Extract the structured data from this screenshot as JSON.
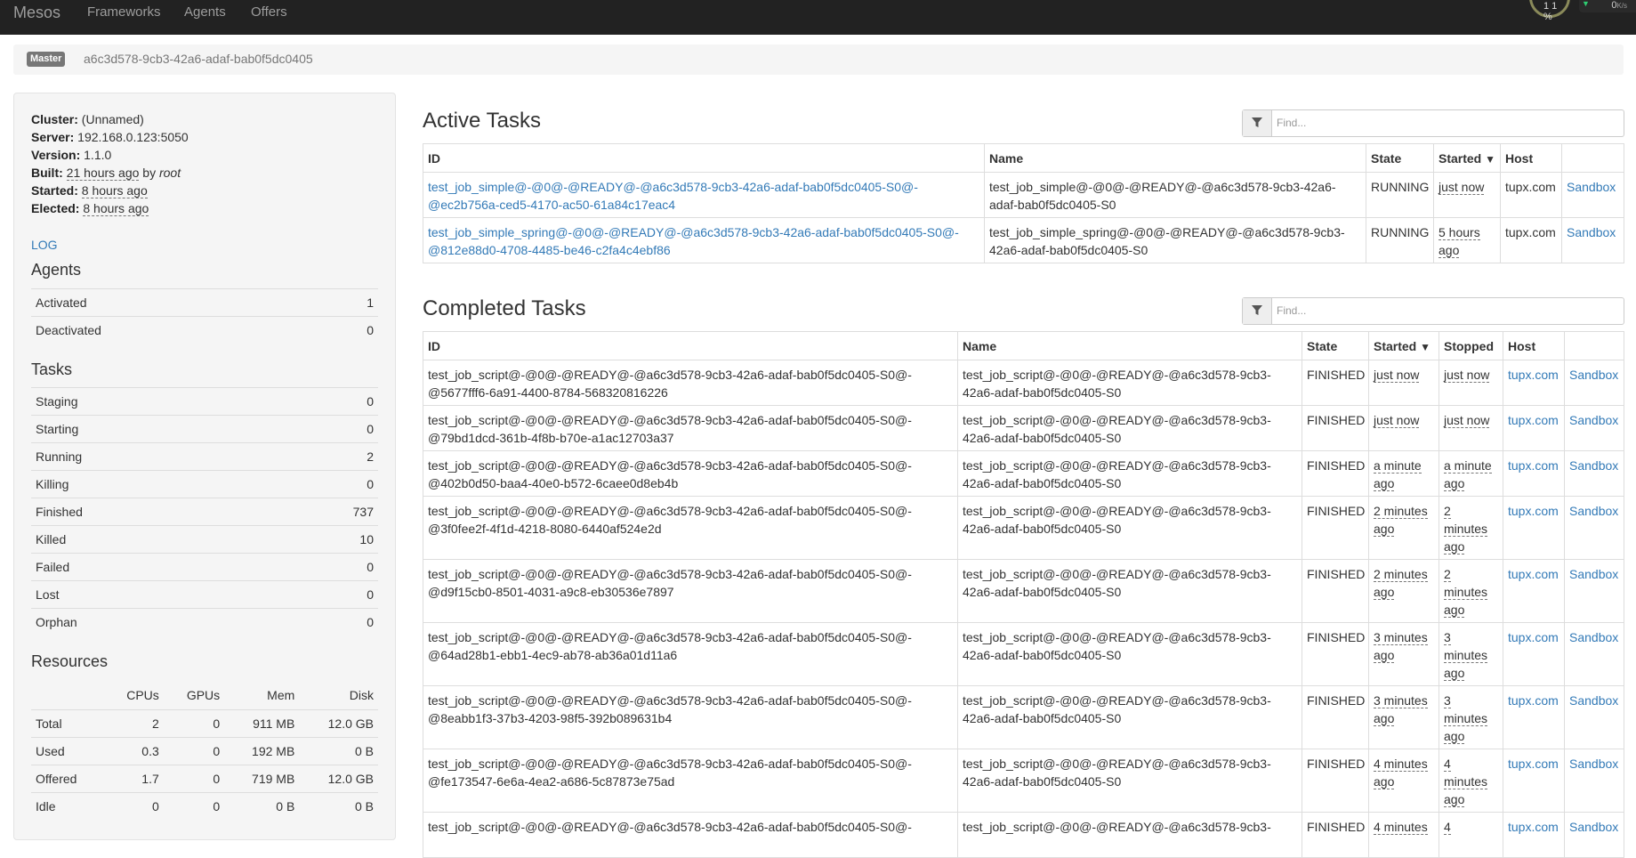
{
  "nav": {
    "brand": "Mesos",
    "links": [
      "Frameworks",
      "Agents",
      "Offers"
    ],
    "widget": {
      "ring_text": "1 1 %",
      "rate": "0",
      "unit": "K/s"
    }
  },
  "breadcrumb": {
    "badge": "Master",
    "id": "a6c3d578-9cb3-42a6-adaf-bab0f5dc0405"
  },
  "sidebar": {
    "cluster_label": "Cluster:",
    "cluster": "(Unnamed)",
    "server_label": "Server:",
    "server": "192.168.0.123:5050",
    "version_label": "Version:",
    "version": "1.1.0",
    "built_label": "Built:",
    "built_time": "21 hours ago",
    "built_by_word": "by",
    "built_by": "root",
    "started_label": "Started:",
    "started": "8 hours ago",
    "elected_label": "Elected:",
    "elected": "8 hours ago",
    "log": "LOG",
    "agents_title": "Agents",
    "agents": [
      {
        "label": "Activated",
        "value": "1"
      },
      {
        "label": "Deactivated",
        "value": "0"
      }
    ],
    "tasks_title": "Tasks",
    "tasks": [
      {
        "label": "Staging",
        "value": "0"
      },
      {
        "label": "Starting",
        "value": "0"
      },
      {
        "label": "Running",
        "value": "2"
      },
      {
        "label": "Killing",
        "value": "0"
      },
      {
        "label": "Finished",
        "value": "737"
      },
      {
        "label": "Killed",
        "value": "10"
      },
      {
        "label": "Failed",
        "value": "0"
      },
      {
        "label": "Lost",
        "value": "0"
      },
      {
        "label": "Orphan",
        "value": "0"
      }
    ],
    "resources_title": "Resources",
    "resources_headers": [
      "",
      "CPUs",
      "GPUs",
      "Mem",
      "Disk"
    ],
    "resources": [
      [
        "Total",
        "2",
        "0",
        "911 MB",
        "12.0 GB"
      ],
      [
        "Used",
        "0.3",
        "0",
        "192 MB",
        "0 B"
      ],
      [
        "Offered",
        "1.7",
        "0",
        "719 MB",
        "12.0 GB"
      ],
      [
        "Idle",
        "0",
        "0",
        "0 B",
        "0 B"
      ]
    ]
  },
  "active": {
    "title": "Active Tasks",
    "search_placeholder": "Find...",
    "headers": {
      "id": "ID",
      "name": "Name",
      "state": "State",
      "started": "Started",
      "host": "Host"
    },
    "sort_caret": "▼",
    "rows": [
      {
        "id1": "test_job_simple@-@0@-@READY@-@a6c3d578-9cb3-42a6-adaf-bab0f5dc0405-S0@-",
        "id2": "@ec2b756a-ced5-4170-ac50-61a84c17eac4",
        "name1": "test_job_simple@-@0@-@READY@-@a6c3d578-9cb3-42a6-",
        "name2": "adaf-bab0f5dc0405-S0",
        "state": "RUNNING",
        "started1": "just now",
        "started2": "",
        "host": "tupx.com",
        "sandbox": "Sandbox"
      },
      {
        "id1": "test_job_simple_spring@-@0@-@READY@-@a6c3d578-9cb3-42a6-adaf-bab0f5dc0405-S0@-",
        "id2": "@812e88d0-4708-4485-be46-c2fa4c4ebf86",
        "name1": "test_job_simple_spring@-@0@-@READY@-@a6c3d578-9cb3-",
        "name2": "42a6-adaf-bab0f5dc0405-S0",
        "state": "RUNNING",
        "started1": "5 hours",
        "started2": "ago",
        "host": "tupx.com",
        "sandbox": "Sandbox"
      }
    ]
  },
  "completed": {
    "title": "Completed Tasks",
    "search_placeholder": "Find...",
    "headers": {
      "id": "ID",
      "name": "Name",
      "state": "State",
      "started": "Started",
      "stopped": "Stopped",
      "host": "Host"
    },
    "sort_caret": "▼",
    "rows": [
      {
        "id1": "test_job_script@-@0@-@READY@-@a6c3d578-9cb3-42a6-adaf-bab0f5dc0405-S0@-",
        "id2": "@5677fff6-6a91-4400-8784-568320816226",
        "name1": "test_job_script@-@0@-@READY@-@a6c3d578-9cb3-",
        "name2": "42a6-adaf-bab0f5dc0405-S0",
        "state": "FINISHED",
        "started": [
          "just now"
        ],
        "stopped": [
          "just now"
        ],
        "host": "tupx.com",
        "sandbox": "Sandbox"
      },
      {
        "id1": "test_job_script@-@0@-@READY@-@a6c3d578-9cb3-42a6-adaf-bab0f5dc0405-S0@-",
        "id2": "@79bd1dcd-361b-4f8b-b70e-a1ac12703a37",
        "name1": "test_job_script@-@0@-@READY@-@a6c3d578-9cb3-",
        "name2": "42a6-adaf-bab0f5dc0405-S0",
        "state": "FINISHED",
        "started": [
          "just now"
        ],
        "stopped": [
          "just now"
        ],
        "host": "tupx.com",
        "sandbox": "Sandbox"
      },
      {
        "id1": "test_job_script@-@0@-@READY@-@a6c3d578-9cb3-42a6-adaf-bab0f5dc0405-S0@-",
        "id2": "@402b0d50-baa4-40e0-b572-6caee0d8eb4b",
        "name1": "test_job_script@-@0@-@READY@-@a6c3d578-9cb3-",
        "name2": "42a6-adaf-bab0f5dc0405-S0",
        "state": "FINISHED",
        "started": [
          "a minute",
          "ago"
        ],
        "stopped": [
          "a minute",
          "ago"
        ],
        "host": "tupx.com",
        "sandbox": "Sandbox"
      },
      {
        "id1": "test_job_script@-@0@-@READY@-@a6c3d578-9cb3-42a6-adaf-bab0f5dc0405-S0@-",
        "id2": "@3f0fee2f-4f1d-4218-8080-6440af524e2d",
        "name1": "test_job_script@-@0@-@READY@-@a6c3d578-9cb3-",
        "name2": "42a6-adaf-bab0f5dc0405-S0",
        "state": "FINISHED",
        "started": [
          "2 minutes",
          "ago"
        ],
        "stopped": [
          "2",
          "minutes",
          "ago"
        ],
        "host": "tupx.com",
        "sandbox": "Sandbox"
      },
      {
        "id1": "test_job_script@-@0@-@READY@-@a6c3d578-9cb3-42a6-adaf-bab0f5dc0405-S0@-",
        "id2": "@d9f15cb0-8501-4031-a9c8-eb30536e7897",
        "name1": "test_job_script@-@0@-@READY@-@a6c3d578-9cb3-",
        "name2": "42a6-adaf-bab0f5dc0405-S0",
        "state": "FINISHED",
        "started": [
          "2 minutes",
          "ago"
        ],
        "stopped": [
          "2",
          "minutes",
          "ago"
        ],
        "host": "tupx.com",
        "sandbox": "Sandbox"
      },
      {
        "id1": "test_job_script@-@0@-@READY@-@a6c3d578-9cb3-42a6-adaf-bab0f5dc0405-S0@-",
        "id2": "@64ad28b1-ebb1-4ec9-ab78-ab36a01d11a6",
        "name1": "test_job_script@-@0@-@READY@-@a6c3d578-9cb3-",
        "name2": "42a6-adaf-bab0f5dc0405-S0",
        "state": "FINISHED",
        "started": [
          "3 minutes",
          "ago"
        ],
        "stopped": [
          "3",
          "minutes",
          "ago"
        ],
        "host": "tupx.com",
        "sandbox": "Sandbox"
      },
      {
        "id1": "test_job_script@-@0@-@READY@-@a6c3d578-9cb3-42a6-adaf-bab0f5dc0405-S0@-",
        "id2": "@8eabb1f3-37b3-4203-98f5-392b089631b4",
        "name1": "test_job_script@-@0@-@READY@-@a6c3d578-9cb3-",
        "name2": "42a6-adaf-bab0f5dc0405-S0",
        "state": "FINISHED",
        "started": [
          "3 minutes",
          "ago"
        ],
        "stopped": [
          "3",
          "minutes",
          "ago"
        ],
        "host": "tupx.com",
        "sandbox": "Sandbox"
      },
      {
        "id1": "test_job_script@-@0@-@READY@-@a6c3d578-9cb3-42a6-adaf-bab0f5dc0405-S0@-",
        "id2": "@fe173547-6e6a-4ea2-a686-5c87873e75ad",
        "name1": "test_job_script@-@0@-@READY@-@a6c3d578-9cb3-",
        "name2": "42a6-adaf-bab0f5dc0405-S0",
        "state": "FINISHED",
        "started": [
          "4 minutes",
          "ago"
        ],
        "stopped": [
          "4",
          "minutes",
          "ago"
        ],
        "host": "tupx.com",
        "sandbox": "Sandbox"
      },
      {
        "id1": "test_job_script@-@0@-@READY@-@a6c3d578-9cb3-42a6-adaf-bab0f5dc0405-S0@-",
        "id2": "",
        "name1": "test_job_script@-@0@-@READY@-@a6c3d578-9cb3-",
        "name2": "",
        "state": "FINISHED",
        "started": [
          "4 minutes"
        ],
        "stopped": [
          "4"
        ],
        "host": "tupx.com",
        "sandbox": "Sandbox"
      }
    ]
  }
}
